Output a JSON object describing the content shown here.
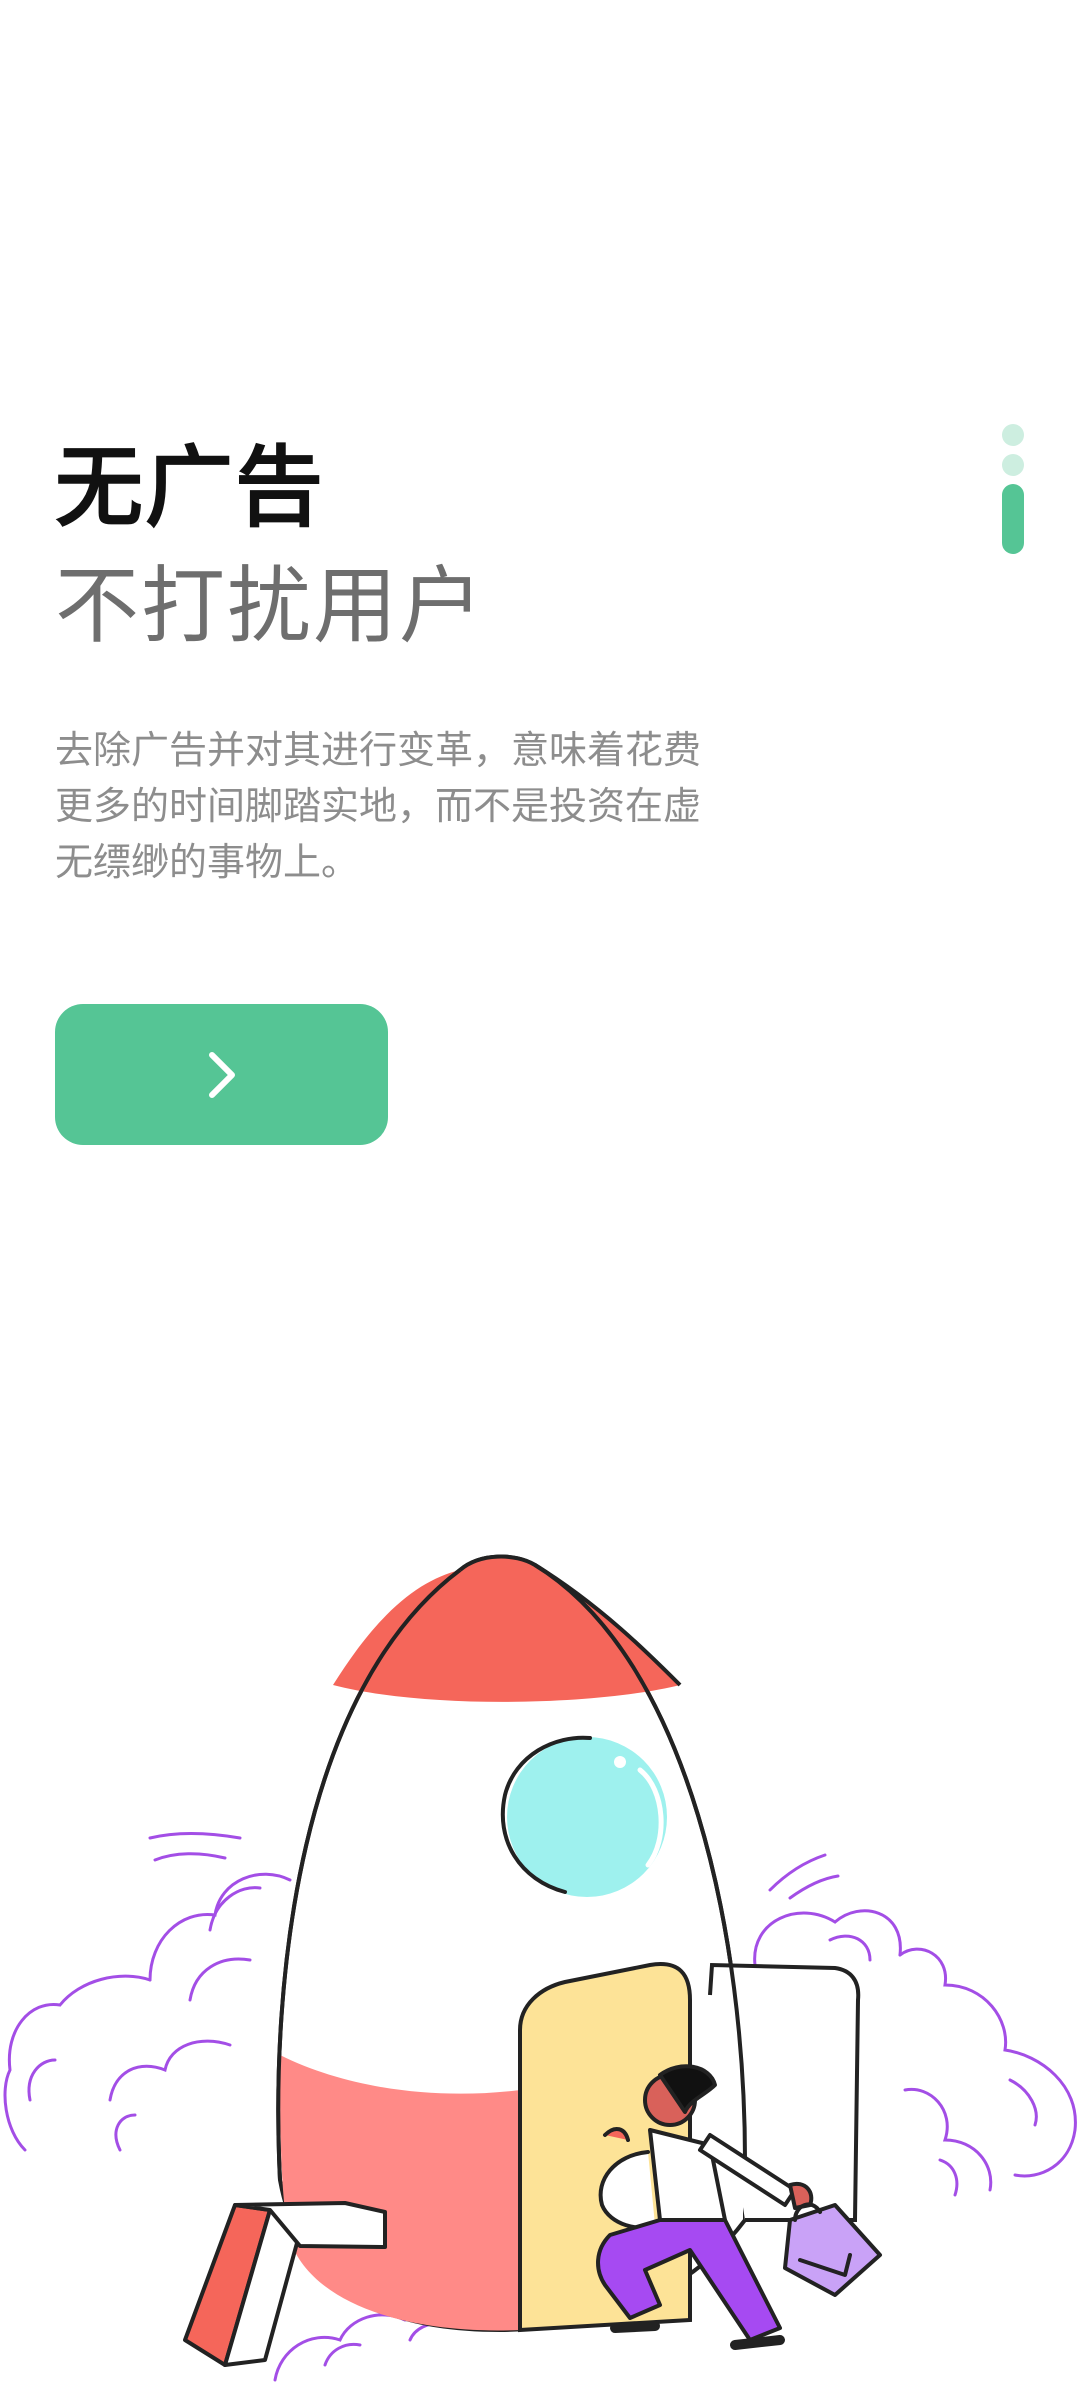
{
  "onboarding": {
    "title": "无广告",
    "subtitle": "不打扰用户",
    "description": "去除广告并对其进行变革，意味着花费更多的时间脚踏实地，而不是投资在虚无缥缈的事物上。",
    "next_icon": "chevron-right-icon",
    "page_indicator": {
      "total": 3,
      "active_index": 2
    }
  },
  "colors": {
    "accent": "#55c595",
    "accent_light": "#cdeee0",
    "title": "#111111",
    "subtitle": "#6e6e6e",
    "body_text": "#8d8d8d",
    "rocket_red": "#f5665a",
    "rocket_pink": "#ff8a87",
    "window_cyan": "#9ef1ee",
    "door_yellow": "#fde397",
    "smoke_purple": "#a34ee6",
    "pants_purple": "#a64af2"
  },
  "illustration": {
    "subject": "rocket-launch-illustration"
  }
}
